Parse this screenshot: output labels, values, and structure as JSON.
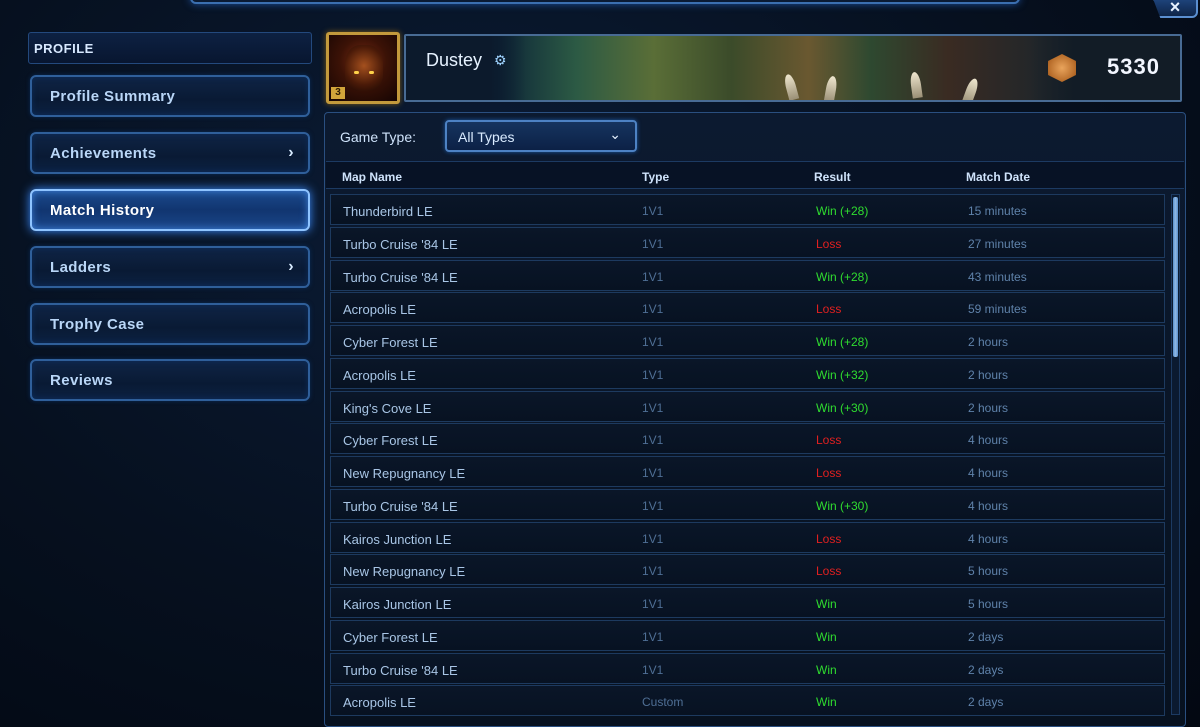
{
  "window": {
    "close_label": "×"
  },
  "sidebar": {
    "header": "PROFILE",
    "items": [
      {
        "label": "Profile Summary",
        "chevron": ""
      },
      {
        "label": "Achievements",
        "chevron": "›"
      },
      {
        "label": "Match History",
        "chevron": ""
      },
      {
        "label": "Ladders",
        "chevron": "›"
      },
      {
        "label": "Trophy Case",
        "chevron": ""
      },
      {
        "label": "Reviews",
        "chevron": ""
      }
    ],
    "active_item": "Match History"
  },
  "player": {
    "name": "Dustey",
    "portrait_level": "3",
    "rating": "5330",
    "settings_icon": "gear-icon",
    "rating_icon": "rank-emblem-icon"
  },
  "filter": {
    "label": "Game Type:",
    "selected": "All Types"
  },
  "table": {
    "columns": [
      "Map Name",
      "Type",
      "Result",
      "Match Date"
    ],
    "rows": [
      {
        "map": "Thunderbird LE",
        "type": "1V1",
        "result": "Win (+28)",
        "outcome": "win",
        "date": "15 minutes"
      },
      {
        "map": "Turbo Cruise '84 LE",
        "type": "1V1",
        "result": "Loss",
        "outcome": "loss",
        "date": "27 minutes"
      },
      {
        "map": "Turbo Cruise '84 LE",
        "type": "1V1",
        "result": "Win (+28)",
        "outcome": "win",
        "date": "43 minutes"
      },
      {
        "map": "Acropolis LE",
        "type": "1V1",
        "result": "Loss",
        "outcome": "loss",
        "date": "59 minutes"
      },
      {
        "map": "Cyber Forest LE",
        "type": "1V1",
        "result": "Win (+28)",
        "outcome": "win",
        "date": "2 hours"
      },
      {
        "map": "Acropolis LE",
        "type": "1V1",
        "result": "Win (+32)",
        "outcome": "win",
        "date": "2 hours"
      },
      {
        "map": "King's Cove LE",
        "type": "1V1",
        "result": "Win (+30)",
        "outcome": "win",
        "date": "2 hours"
      },
      {
        "map": "Cyber Forest LE",
        "type": "1V1",
        "result": "Loss",
        "outcome": "loss",
        "date": "4 hours"
      },
      {
        "map": "New Repugnancy LE",
        "type": "1V1",
        "result": "Loss",
        "outcome": "loss",
        "date": "4 hours"
      },
      {
        "map": "Turbo Cruise '84 LE",
        "type": "1V1",
        "result": "Win (+30)",
        "outcome": "win",
        "date": "4 hours"
      },
      {
        "map": "Kairos Junction LE",
        "type": "1V1",
        "result": "Loss",
        "outcome": "loss",
        "date": "4 hours"
      },
      {
        "map": "New Repugnancy LE",
        "type": "1V1",
        "result": "Loss",
        "outcome": "loss",
        "date": "5 hours"
      },
      {
        "map": "Kairos Junction LE",
        "type": "1V1",
        "result": "Win",
        "outcome": "win",
        "date": "5 hours"
      },
      {
        "map": "Cyber Forest LE",
        "type": "1V1",
        "result": "Win",
        "outcome": "win",
        "date": "2 days"
      },
      {
        "map": "Turbo Cruise '84 LE",
        "type": "1V1",
        "result": "Win",
        "outcome": "win",
        "date": "2 days"
      },
      {
        "map": "Acropolis LE",
        "type": "Custom",
        "result": "Win",
        "outcome": "win",
        "date": "2 days"
      }
    ]
  },
  "colors": {
    "win": "#2fdc2f",
    "loss": "#e02020",
    "accent": "#4d82c4",
    "rating_gold": "#c39a3c"
  }
}
